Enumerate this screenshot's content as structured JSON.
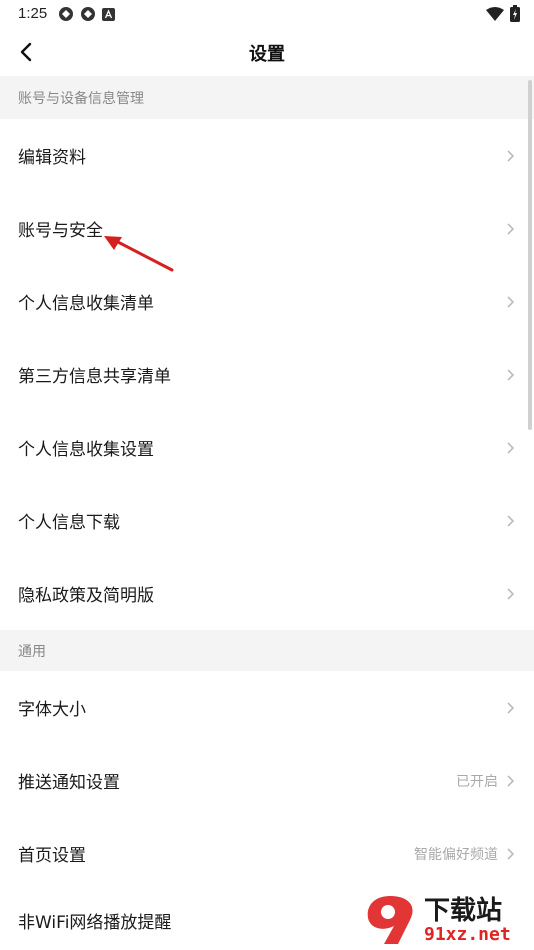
{
  "status_bar": {
    "time": "1:25"
  },
  "header": {
    "title": "设置"
  },
  "sections": [
    {
      "title": "账号与设备信息管理",
      "items": [
        {
          "label": "编辑资料",
          "value": ""
        },
        {
          "label": "账号与安全",
          "value": ""
        },
        {
          "label": "个人信息收集清单",
          "value": ""
        },
        {
          "label": "第三方信息共享清单",
          "value": ""
        },
        {
          "label": "个人信息收集设置",
          "value": ""
        },
        {
          "label": "个人信息下载",
          "value": ""
        },
        {
          "label": "隐私政策及简明版",
          "value": ""
        }
      ]
    },
    {
      "title": "通用",
      "items": [
        {
          "label": "字体大小",
          "value": ""
        },
        {
          "label": "推送通知设置",
          "value": "已开启"
        },
        {
          "label": "首页设置",
          "value": "智能偏好频道"
        },
        {
          "label": "非WiFi网络播放提醒",
          "value": ""
        }
      ]
    }
  ],
  "watermark": {
    "main": "下载站",
    "site": "91xz.net"
  },
  "colors": {
    "annotation_arrow": "#d62020",
    "watermark_red": "#e02424"
  }
}
